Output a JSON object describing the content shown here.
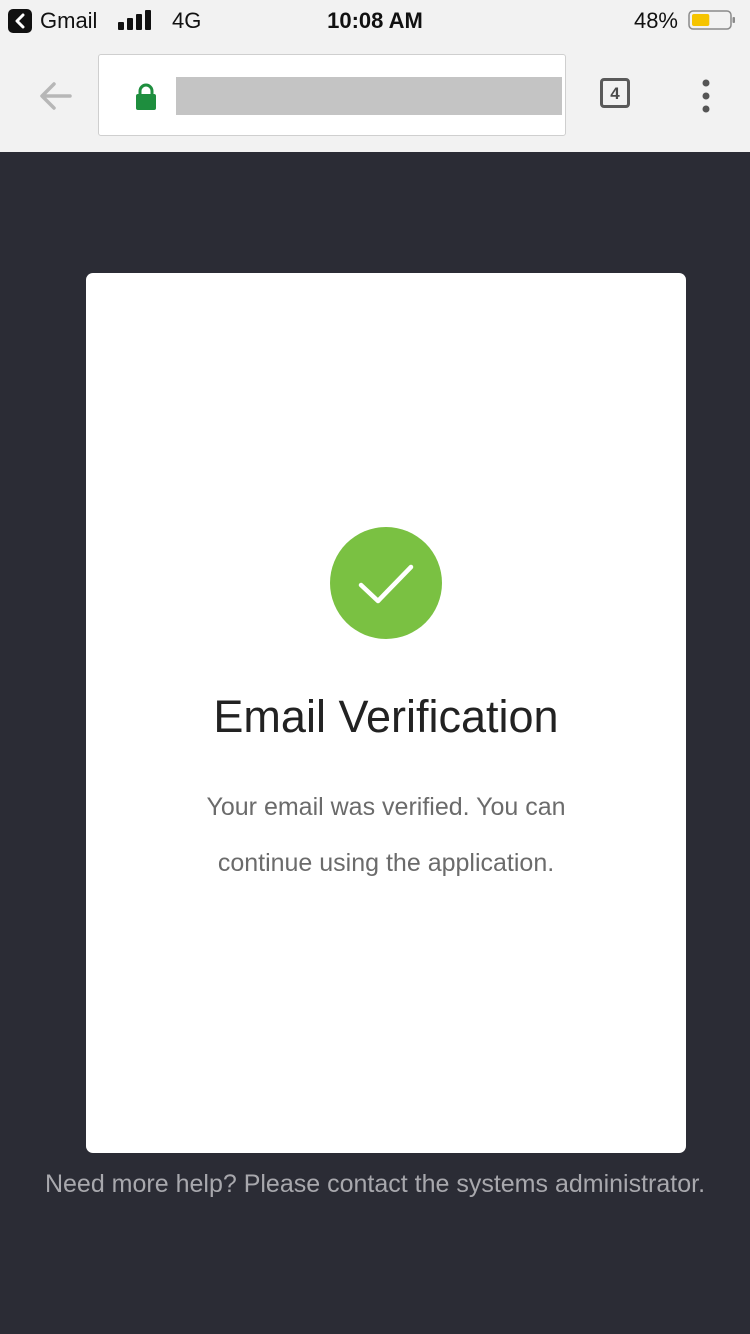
{
  "status_bar": {
    "back_app_label": "Gmail",
    "network": "4G",
    "time": "10:08 AM",
    "battery_percent": "48%",
    "battery_level": 0.48,
    "battery_color": "#f5c400"
  },
  "browser": {
    "url": "",
    "tab_count": "4",
    "lock_color": "#1e8e3e"
  },
  "card": {
    "title": "Email Verification",
    "message": "Your email was verified. You can continue using the application.",
    "check_color": "#7ac142"
  },
  "footer": {
    "help_text": "Need more help? Please contact the systems administrator."
  }
}
